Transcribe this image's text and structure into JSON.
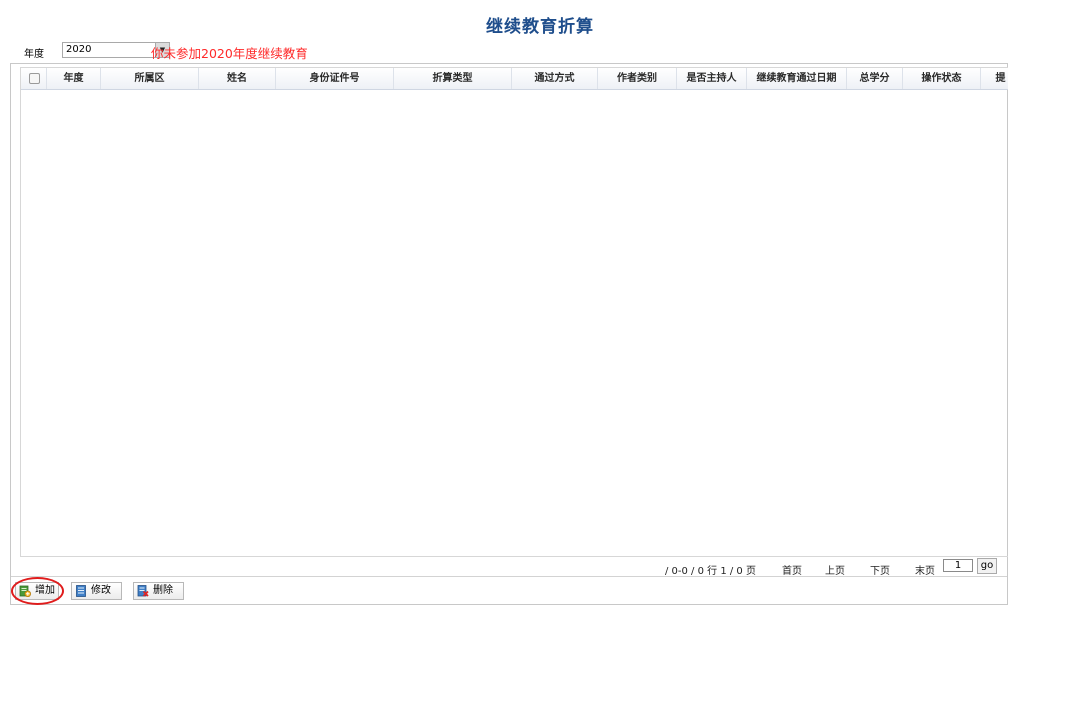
{
  "page": {
    "title": "继续教育折算"
  },
  "filter": {
    "year_label": "年度",
    "year_value": "2020",
    "notice": "你未参加2020年度继续教育"
  },
  "grid": {
    "columns": [
      "年度",
      "所属区",
      "姓名",
      "身份证件号",
      "折算类型",
      "通过方式",
      "作者类别",
      "是否主持人",
      "继续教育通过日期",
      "总学分",
      "操作状态",
      "提"
    ],
    "rows": []
  },
  "pager": {
    "info": "/ 0-0 / 0 行 1 / 0 页",
    "first": "首页",
    "prev": "上页",
    "next": "下页",
    "last": "末页",
    "page_input": "1",
    "go": "go"
  },
  "toolbar": {
    "add": "增加",
    "edit": "修改",
    "delete": "删除"
  },
  "colors": {
    "title": "#1f4e8c",
    "notice": "#ff2a2a",
    "highlight_circle": "#e01c1c"
  }
}
